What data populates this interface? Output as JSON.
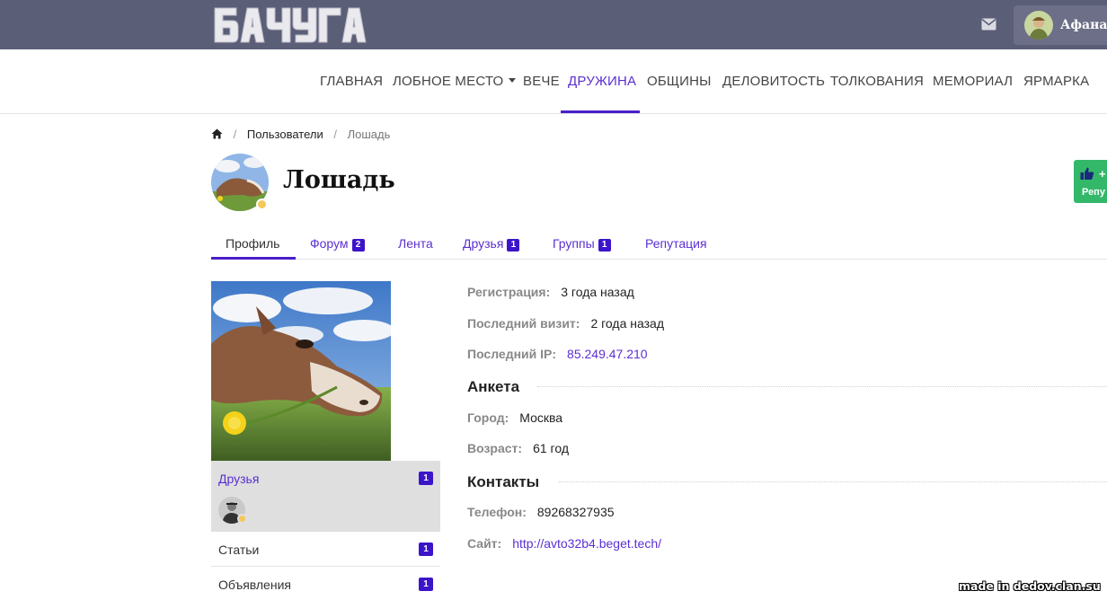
{
  "header": {
    "logo_text": "БАЧУГА",
    "mail_icon": "envelope-icon",
    "user_name": "Афанас"
  },
  "nav": {
    "items": [
      {
        "label": "ГЛАВНАЯ"
      },
      {
        "label": "ЛОБНОЕ МЕСТО"
      },
      {
        "label": "ВЕЧЕ"
      },
      {
        "label": "ДРУЖИНА"
      },
      {
        "label": "ОБЩИНЫ"
      },
      {
        "label": "ДЕЛОВИТОСТЬ"
      },
      {
        "label": "ТОЛКОВАНИЯ"
      },
      {
        "label": "МЕМОРИАЛ"
      },
      {
        "label": "ЯРМАРКА"
      }
    ],
    "active": "ДРУЖИНА"
  },
  "breadcrumb": {
    "home_icon": "home-icon",
    "sep": "/",
    "users": "Пользователи",
    "current": "Лошадь"
  },
  "profile": {
    "name": "Лошадь",
    "rep_plus": "+",
    "rep_label": "Репу"
  },
  "tabs": {
    "profile": "Профиль",
    "forum": "Форум",
    "forum_count": "2",
    "feed": "Лента",
    "friends": "Друзья",
    "friends_count": "1",
    "groups": "Группы",
    "groups_count": "1",
    "reputation": "Репутация"
  },
  "sidebar": {
    "friends_label": "Друзья",
    "friends_count": "1",
    "articles_label": "Статьи",
    "articles_count": "1",
    "ads_label": "Объявления",
    "ads_count": "1"
  },
  "details": {
    "reg_key": "Регистрация:",
    "reg_val": "3 года назад",
    "visit_key": "Последний визит:",
    "visit_val": "2 года назад",
    "ip_key": "Последний IP:",
    "ip_val": "85.249.47.210",
    "anketa": "Анкета",
    "city_key": "Город:",
    "city_val": "Москва",
    "age_key": "Возраст:",
    "age_val": "61 год",
    "contacts": "Контакты",
    "phone_key": "Телефон:",
    "phone_val": "89268327935",
    "site_key": "Сайт:",
    "site_val": "http://avto32b4.beget.tech/"
  },
  "watermark": "made in dedov.clan.su",
  "colors": {
    "topbar": "#5b5e77",
    "accent": "#4a1fc9",
    "link": "#5b2fd1",
    "rep_green": "#33b86a"
  }
}
